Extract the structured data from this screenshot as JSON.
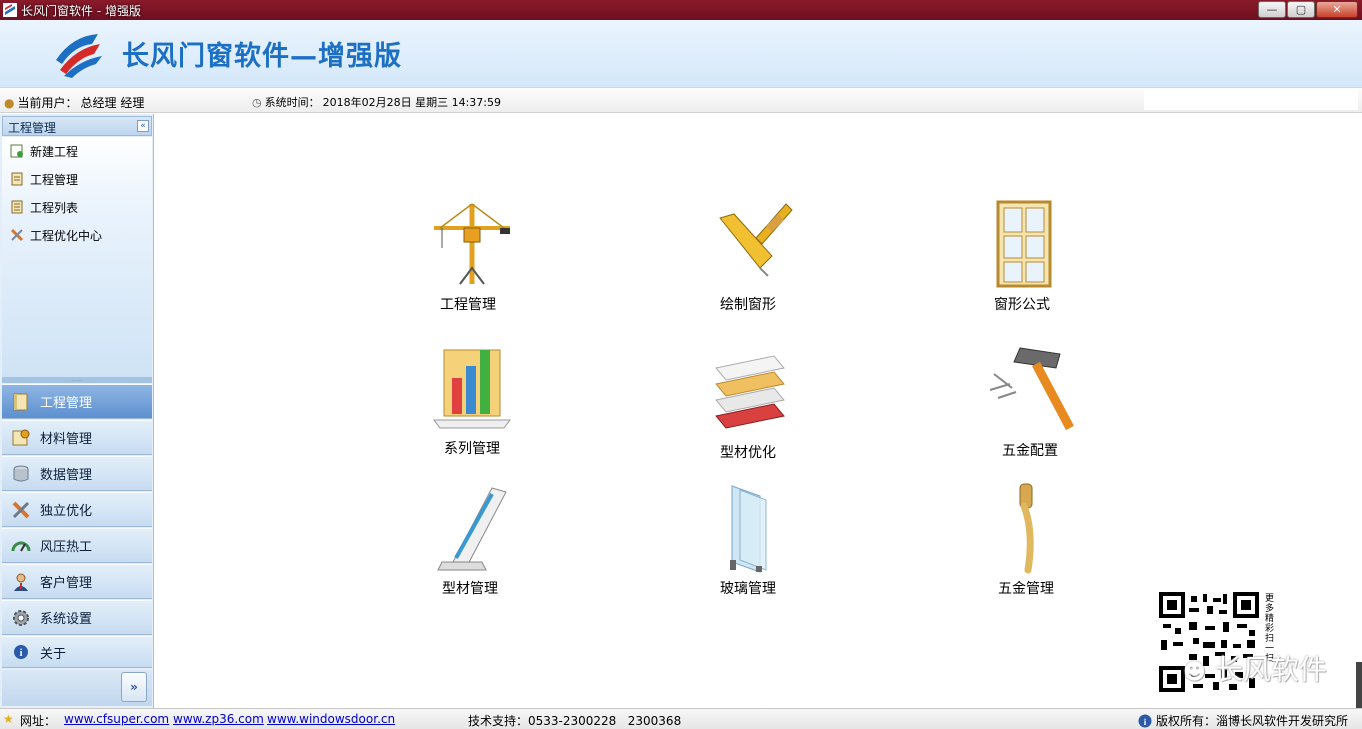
{
  "window": {
    "title": "长风门窗软件 - 增强版",
    "controls": {
      "minimize": "—",
      "maximize": "▢",
      "close": "✕"
    }
  },
  "banner": {
    "brand": "长风门窗软件—增强版"
  },
  "status": {
    "user_label": "当前用户：",
    "user_value": "总经理 经理",
    "time_label": "系统时间：",
    "time_value": "2018年02月28日 星期三 14:37:59"
  },
  "sidebar": {
    "header": "工程管理",
    "links": [
      {
        "label": "新建工程",
        "icon": "new-project-icon"
      },
      {
        "label": "工程管理",
        "icon": "project-document-icon"
      },
      {
        "label": "工程列表",
        "icon": "project-list-icon"
      },
      {
        "label": "工程优化中心",
        "icon": "optimize-tools-icon"
      }
    ],
    "nav": [
      {
        "label": "工程管理",
        "icon": "book-icon",
        "active": true
      },
      {
        "label": "材料管理",
        "icon": "material-icon",
        "active": false
      },
      {
        "label": "数据管理",
        "icon": "database-icon",
        "active": false
      },
      {
        "label": "独立优化",
        "icon": "tools-icon",
        "active": false
      },
      {
        "label": "风压热工",
        "icon": "gauge-icon",
        "active": false
      },
      {
        "label": "客户管理",
        "icon": "customer-icon",
        "active": false
      },
      {
        "label": "系统设置",
        "icon": "settings-icon",
        "active": false
      },
      {
        "label": "关于",
        "icon": "info-icon",
        "active": false
      }
    ]
  },
  "tiles": [
    {
      "label": "工程管理",
      "icon": "crane-icon"
    },
    {
      "label": "绘制窗形",
      "icon": "ruler-icon"
    },
    {
      "label": "窗形公式",
      "icon": "window-icon"
    },
    {
      "label": "系列管理",
      "icon": "bar-chart-icon"
    },
    {
      "label": "型材优化",
      "icon": "profile-stack-icon"
    },
    {
      "label": "五金配置",
      "icon": "hammer-icon"
    },
    {
      "label": "型材管理",
      "icon": "profile-corner-icon"
    },
    {
      "label": "玻璃管理",
      "icon": "glass-icon"
    },
    {
      "label": "五金管理",
      "icon": "handle-icon"
    }
  ],
  "promo": {
    "vertical_text": "更多精彩扫一扫",
    "brand": "长风软件"
  },
  "footer": {
    "site_label": "网址：",
    "links": [
      "www.cfsuper.com",
      "www.zp36.com",
      "www.windowsdoor.cn"
    ],
    "support": "技术支持：0533-2300228   2300368",
    "copyright": "版权所有：淄博长风软件开发研究所"
  }
}
